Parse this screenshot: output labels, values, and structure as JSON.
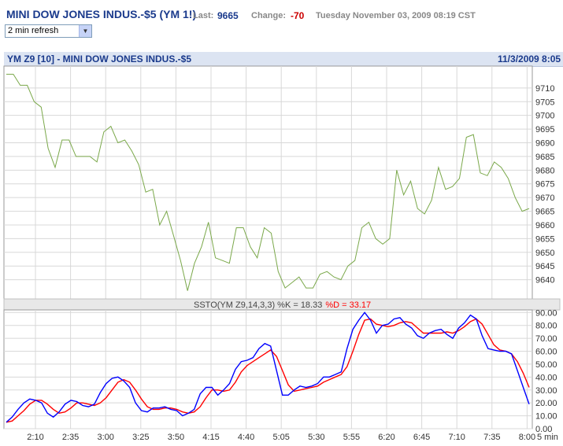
{
  "quote": {
    "title": "MINI DOW JONES INDUS.-$5 (YM 1!)",
    "last_label": "Last:",
    "last_value": "9665",
    "change_label": "Change:",
    "change_value": "-70",
    "timestamp": "Tuesday November 03, 2009 08:19 CST"
  },
  "refresh_select": {
    "selected": "2 min refresh"
  },
  "chart_header": {
    "title": "YM Z9 [10] - MINI DOW JONES INDUS.-$5",
    "date": "11/3/2009 8:05"
  },
  "indicator": {
    "prefix": "SSTO(YM Z9,14,3,3) %K = 18.33",
    "d_text": "%D = 33.17",
    "d_color": "#ff0000"
  },
  "colors": {
    "price": "#7aa84a",
    "k": "#0000ff",
    "d": "#ff0000",
    "grid": "#d8d8d8"
  },
  "chart_data": [
    {
      "type": "line",
      "title": "YM Z9 [10] - MINI DOW JONES INDUS.-$5",
      "series": [
        {
          "values": [
            9715,
            9715,
            9711,
            9711,
            9705,
            9703,
            9688,
            9681,
            9691,
            9691,
            9685,
            9685,
            9685,
            9683,
            9694,
            9696,
            9690,
            9691,
            9687,
            9682,
            9672,
            9673,
            9660,
            9665,
            9656,
            9647,
            9636,
            9646,
            9652,
            9661,
            9648,
            9647,
            9646,
            9659,
            9659,
            9652,
            9648,
            9659,
            9657,
            9643,
            9637,
            9639,
            9641,
            9637,
            9637,
            9642,
            9643,
            9641,
            9640,
            9645,
            9647,
            9659,
            9661,
            9655,
            9653,
            9655,
            9680,
            9671,
            9676,
            9666,
            9664,
            9669,
            9681,
            9673,
            9674,
            9677,
            9692,
            9693,
            9679,
            9678,
            9683,
            9681,
            9677,
            9670,
            9665,
            9666
          ]
        }
      ],
      "ylim": [
        9633,
        9718
      ],
      "y_ticks": [
        "9710",
        "9705",
        "9700",
        "9695",
        "9690",
        "9685",
        "9680",
        "9675",
        "9670",
        "9665",
        "9660",
        "9655",
        "9650",
        "9645",
        "9640"
      ]
    },
    {
      "type": "line",
      "title": "SSTO(YM Z9,14,3,3)",
      "series": [
        {
          "name": "%K",
          "values": [
            5,
            9,
            15,
            20,
            23,
            22,
            20,
            12,
            9,
            13,
            19,
            22,
            21,
            18,
            17,
            19,
            28,
            35,
            39,
            40,
            37,
            32,
            20,
            14,
            13,
            16,
            16,
            17,
            15,
            14,
            10,
            12,
            15,
            27,
            32,
            32,
            26,
            30,
            35,
            46,
            52,
            53,
            55,
            62,
            66,
            64,
            45,
            26,
            26,
            30,
            33,
            32,
            33,
            35,
            40,
            40,
            42,
            44,
            62,
            77,
            84,
            90,
            84,
            74,
            80,
            81,
            85,
            86,
            81,
            78,
            72,
            70,
            74,
            76,
            77,
            73,
            70,
            78,
            82,
            88,
            85,
            72,
            62,
            61,
            60,
            60,
            58,
            45,
            32,
            19
          ]
        },
        {
          "name": "%D",
          "values": [
            5,
            6,
            10,
            14,
            19,
            22,
            22,
            19,
            15,
            12,
            13,
            16,
            20,
            20,
            19,
            18,
            20,
            24,
            30,
            36,
            38,
            36,
            30,
            23,
            17,
            15,
            15,
            16,
            16,
            15,
            13,
            12,
            13,
            17,
            24,
            30,
            30,
            29,
            30,
            36,
            44,
            49,
            52,
            55,
            58,
            61,
            56,
            45,
            34,
            29,
            30,
            31,
            32,
            33,
            36,
            38,
            40,
            42,
            48,
            60,
            73,
            84,
            85,
            81,
            80,
            79,
            80,
            82,
            83,
            82,
            78,
            74,
            74,
            74,
            74,
            75,
            74,
            76,
            79,
            83,
            85,
            81,
            73,
            65,
            61,
            60,
            58,
            52,
            43,
            32
          ]
        }
      ],
      "ylim": [
        0,
        92
      ],
      "y_ticks": [
        "90.00",
        "80.00",
        "70.00",
        "60.00",
        "50.00",
        "40.00",
        "30.00",
        "20.00",
        "10.00",
        "0.00"
      ],
      "x_ticks": [
        "2:10",
        "2:35",
        "3:00",
        "3:25",
        "3:50",
        "4:15",
        "4:40",
        "5:05",
        "5:30",
        "5:55",
        "6:20",
        "6:45",
        "7:10",
        "7:35",
        "8:00"
      ],
      "xlabel": "5 min"
    }
  ]
}
